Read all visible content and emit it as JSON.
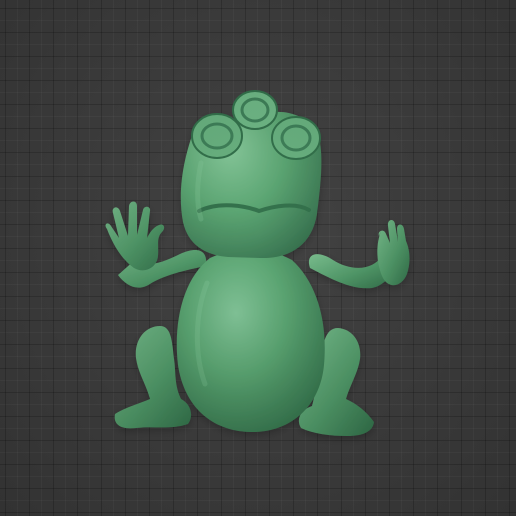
{
  "viewport": {
    "background_color": "#3d3d3d",
    "grid": true,
    "grid_color": "#2f2f2f"
  },
  "model": {
    "subject": "frog-figure",
    "material_color": "#4f9a68",
    "shadow_color": "#2f6f48",
    "highlight_color": "#7ec596"
  }
}
